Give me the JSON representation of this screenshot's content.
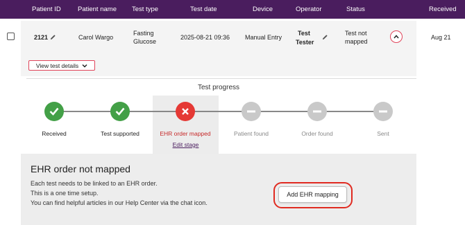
{
  "header": {
    "patient_id": "Patient ID",
    "patient_name": "Patient name",
    "test_type": "Test type",
    "test_date": "Test date",
    "device": "Device",
    "operator": "Operator",
    "status": "Status",
    "received": "Received"
  },
  "row": {
    "patient_id": "2121",
    "patient_name": "Carol Wargo",
    "test_type_line1": "Fasting",
    "test_type_line2": "Glucose",
    "test_date": "2025-08-21 09:36",
    "device": "Manual Entry",
    "operator_line1": "Test",
    "operator_line2": "Tester",
    "status_line1": "Test not",
    "status_line2": "mapped",
    "received": "Aug 21",
    "view_details_label": "View test details"
  },
  "progress": {
    "title": "Test progress",
    "steps": [
      {
        "label": "Received",
        "state": "done"
      },
      {
        "label": "Test supported",
        "state": "done"
      },
      {
        "label": "EHR order mapped",
        "state": "error"
      },
      {
        "label": "Patient found",
        "state": "pending"
      },
      {
        "label": "Order found",
        "state": "pending"
      },
      {
        "label": "Sent",
        "state": "pending"
      }
    ],
    "edit_stage_label": "Edit stage"
  },
  "panel": {
    "title": "EHR order not mapped",
    "lines": [
      "Each test needs to be linked to an EHR order.",
      "This is a one time setup.",
      "You can find helpful articles in our Help Center via the chat icon."
    ],
    "button_label": "Add EHR mapping"
  },
  "colors": {
    "header_bg": "#4a1d5e",
    "done": "#43a047",
    "error": "#e53935",
    "pending": "#c9c9c9",
    "highlight": "#e02a20"
  }
}
